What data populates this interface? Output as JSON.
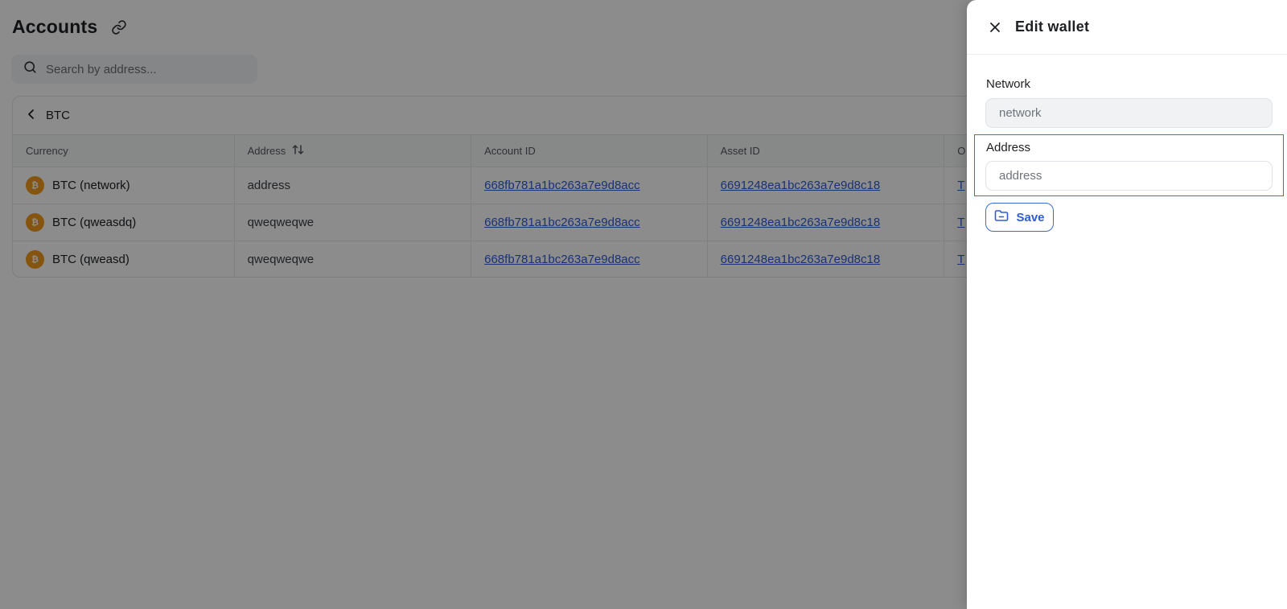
{
  "page": {
    "title": "Accounts",
    "search": {
      "placeholder": "Search by address...",
      "value": ""
    },
    "breadcrumb": {
      "label": "BTC"
    },
    "table": {
      "columns": [
        "Currency",
        "Address",
        "Account ID",
        "Asset ID",
        "O"
      ],
      "rows": [
        {
          "currency": "BTC (network)",
          "coin_symbol": "₿",
          "address": "address",
          "account_id": "668fb781a1bc263a7e9d8acc",
          "asset_id": "6691248ea1bc263a7e9d8c18",
          "extra": "T"
        },
        {
          "currency": "BTC (qweasdq)",
          "coin_symbol": "₿",
          "address": "qweqweqwe",
          "account_id": "668fb781a1bc263a7e9d8acc",
          "asset_id": "6691248ea1bc263a7e9d8c18",
          "extra": "T"
        },
        {
          "currency": "BTC (qweasd)",
          "coin_symbol": "₿",
          "address": "qweqweqwe",
          "account_id": "668fb781a1bc263a7e9d8acc",
          "asset_id": "6691248ea1bc263a7e9d8c18",
          "extra": "T"
        }
      ]
    }
  },
  "drawer": {
    "title": "Edit wallet",
    "network": {
      "label": "Network",
      "placeholder": "network",
      "value": ""
    },
    "address": {
      "label": "Address",
      "placeholder": "address",
      "value": ""
    },
    "save_label": "Save"
  },
  "colors": {
    "accent": "#2f5bd8",
    "coin": "#f29a1b",
    "highlight": "#e5383b",
    "overlay": "rgba(0,0,0,0.45)"
  },
  "icons": [
    "link-icon",
    "search-icon",
    "chevron-left-icon",
    "sort-icon",
    "bitcoin-icon",
    "close-icon",
    "folder-icon"
  ]
}
